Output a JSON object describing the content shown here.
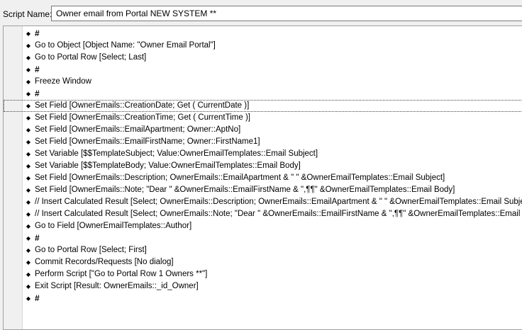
{
  "header": {
    "label": "Script Name:",
    "script_name": "Owner email from Portal NEW SYSTEM **"
  },
  "steps": [
    {
      "text": "#",
      "type": "comment"
    },
    {
      "text": "Go to Object [Object Name: \"Owner Email Portal\"]",
      "type": "step"
    },
    {
      "text": "Go to Portal Row [Select; Last]",
      "type": "step"
    },
    {
      "text": "#",
      "type": "comment"
    },
    {
      "text": "Freeze Window",
      "type": "step"
    },
    {
      "text": "#",
      "type": "comment"
    },
    {
      "text": "Set Field [OwnerEmails::CreationDate; Get ( CurrentDate )]",
      "type": "step",
      "selected": true
    },
    {
      "text": "Set Field [OwnerEmails::CreationTime; Get ( CurrentTime )]",
      "type": "step"
    },
    {
      "text": "Set Field [OwnerEmails::EmailApartment; Owner::AptNo]",
      "type": "step"
    },
    {
      "text": "Set Field [OwnerEmails::EmailFirstName; Owner::FirstName1]",
      "type": "step"
    },
    {
      "text": "Set Variable [$$TemplateSubject; Value:OwnerEmailTemplates::Email Subject]",
      "type": "step"
    },
    {
      "text": "Set Variable [$$TemplateBody; Value:OwnerEmailTemplates::Email Body]",
      "type": "step"
    },
    {
      "text": "Set Field [OwnerEmails::Description; OwnerEmails::EmailApartment & \" \" &OwnerEmailTemplates::Email Subject]",
      "type": "step"
    },
    {
      "text": "Set Field [OwnerEmails::Note; \"Dear \" &OwnerEmails::EmailFirstName & \",¶¶\" &OwnerEmailTemplates::Email Body]",
      "type": "step"
    },
    {
      "text": "//  Insert Calculated Result [Select; OwnerEmails::Description; OwnerEmails::EmailApartment & \" \" &OwnerEmailTemplates::Email Subject]",
      "type": "step"
    },
    {
      "text": "//  Insert Calculated Result [Select; OwnerEmails::Note; \"Dear \" &OwnerEmails::EmailFirstName & \",¶¶\" &OwnerEmailTemplates::Email Body]",
      "type": "step"
    },
    {
      "text": "Go to Field [OwnerEmailTemplates::Author]",
      "type": "step"
    },
    {
      "text": "#",
      "type": "comment"
    },
    {
      "text": "Go to Portal Row [Select; First]",
      "type": "step"
    },
    {
      "text": "Commit Records/Requests [No dialog]",
      "type": "step"
    },
    {
      "text": "Perform Script [\"Go to Portal Row 1 Owners **\"]",
      "type": "step"
    },
    {
      "text": "Exit Script [Result: OwnerEmails::_id_Owner]",
      "type": "step"
    },
    {
      "text": "#",
      "type": "comment"
    }
  ],
  "icons": {
    "grip": "drag-handle-icon"
  }
}
